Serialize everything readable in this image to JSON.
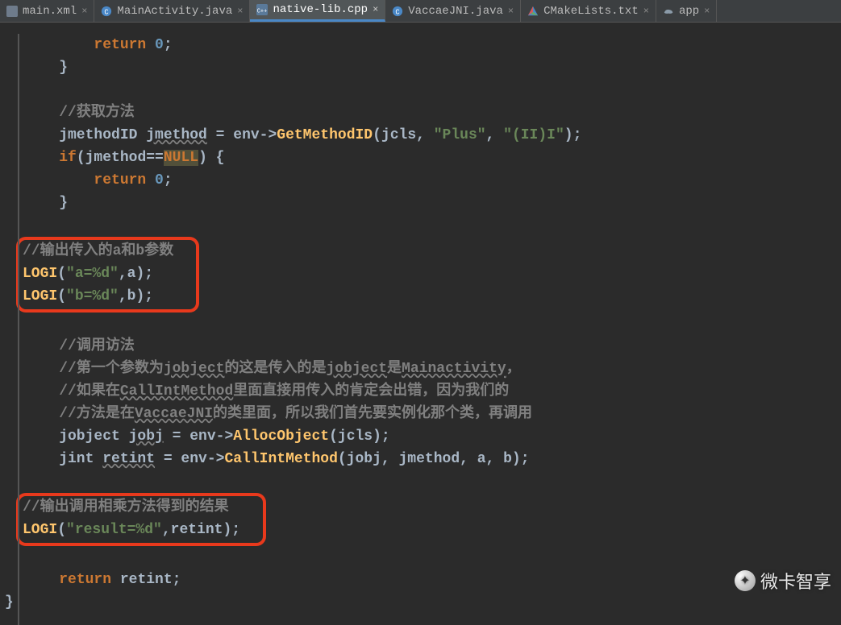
{
  "tabs": [
    {
      "label": "main.xml",
      "icon": "xml"
    },
    {
      "label": "MainActivity.java",
      "icon": "java"
    },
    {
      "label": "native-lib.cpp",
      "icon": "cpp",
      "active": true
    },
    {
      "label": "VaccaeJNI.java",
      "icon": "java"
    },
    {
      "label": "CMakeLists.txt",
      "icon": "cmake"
    },
    {
      "label": "app",
      "icon": "gradle"
    }
  ],
  "code": {
    "l1a": "        ",
    "l1b": "return ",
    "l1c": "0",
    "l1d": ";",
    "l2": "    }",
    "l3": "",
    "l4a": "    ",
    "l4b": "//获取方法",
    "l5a": "    jmethodID ",
    "l5b": "jmethod",
    " l5c": " = env->",
    "l5d": "GetMethodID",
    "l5e": "(jcls, ",
    "l5f": "\"Plus\"",
    "l5g": ", ",
    "l5h": "\"(II)I\"",
    "l5i": ");",
    "l6a": "    ",
    "l6b": "if",
    "l6c": "(jmethod==",
    "l6d": "NULL",
    "l6e": ") {",
    "l7a": "        ",
    "l7b": "return ",
    "l7c": "0",
    "l7d": ";",
    "l8": "    }",
    "l9": "",
    "l10": "//输出传入的a和b参数",
    "l11a": "LOGI",
    "l11b": "(",
    "l11c": "\"a=%d\"",
    "l11d": ",a);",
    "l12a": "LOGI",
    "l12b": "(",
    "l12c": "\"b=%d\"",
    "l12d": ",b);",
    "l13": "",
    "l14a": "    ",
    "l14b": "//调用访法",
    "l15a": "    ",
    "l15b": "//第一个参数为",
    "l15c": "jobject",
    "l15d": "的这是传入的是",
    "l15e": "jobject",
    "l15f": "是",
    "l15g": "Mainactivity",
    "l15h": "，",
    "l16a": "    ",
    "l16b": "//如果在",
    "l16c": "CallIntMethod",
    "l16d": "里面直接用传入的肯定会出错，因为我们的",
    "l17a": "    ",
    "l17b": "//方法是在",
    "l17c": "VaccaeJNI",
    "l17d": "的类里面，所以我们首先要实例化那个类，再调用",
    "l18a": "    jobject ",
    "l18b": "jobj",
    "l18c": " = env->",
    "l18d": "AllocObject",
    "l18e": "(jcls);",
    "l19a": "    jint ",
    "l19b": "retint",
    "l19c": " = env->",
    "l19d": "CallIntMethod",
    "l19e": "(jobj, jmethod, a, b);",
    "l20": "",
    "l21": "//输出调用相乘方法得到的结果",
    "l22a": "LOGI",
    "l22b": "(",
    "l22c": "\"result=%d\"",
    "l22d": ",retint);",
    "l23": "",
    "l24a": "    ",
    "l24b": "return ",
    "l24c": "retint;",
    "l25": "}"
  },
  "watermark": "微卡智享"
}
